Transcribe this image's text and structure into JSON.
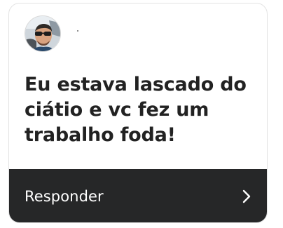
{
  "card": {
    "message": "Eu estava lascado do ciátio e vc fez um trabalho foda!",
    "reply_label": "Responder",
    "avatar_icon": "user-avatar-photo",
    "reply_icon": "chevron-right-icon"
  },
  "colors": {
    "card_background": "#ffffff",
    "reply_bar_background": "#262728",
    "message_text": "#222222",
    "reply_text": "#ffffff"
  }
}
